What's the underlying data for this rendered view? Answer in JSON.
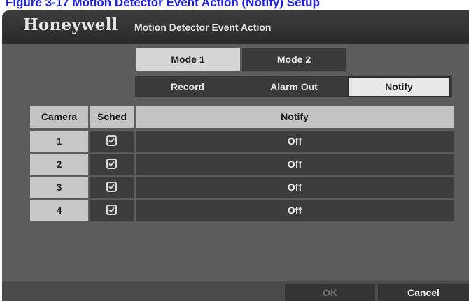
{
  "caption": "Figure 3-17     Motion Detector Event Action (Notify) Setup",
  "header": {
    "brand": "Honeywell",
    "title": "Motion Detector Event Action"
  },
  "mode_tabs": [
    {
      "label": "Mode 1",
      "selected": true
    },
    {
      "label": "Mode 2",
      "selected": false
    }
  ],
  "action_tabs": [
    {
      "label": "Record",
      "selected": false
    },
    {
      "label": "Alarm Out",
      "selected": false
    },
    {
      "label": "Notify",
      "selected": true
    }
  ],
  "table": {
    "columns": [
      "Camera",
      "Sched",
      "Notify"
    ],
    "rows": [
      {
        "camera": "1",
        "sched": true,
        "notify": "Off"
      },
      {
        "camera": "2",
        "sched": true,
        "notify": "Off"
      },
      {
        "camera": "3",
        "sched": true,
        "notify": "Off"
      },
      {
        "camera": "4",
        "sched": true,
        "notify": "Off"
      }
    ]
  },
  "footer": {
    "ok_label": "OK",
    "ok_enabled": false,
    "cancel_label": "Cancel"
  },
  "colors": {
    "caption": "#1f1fe0",
    "panel_background": "#5c5c5c",
    "selected_tab": "#d6d6d6",
    "dark_cell": "#3c3c3c"
  },
  "icons": [
    "checkbox-checked-icon"
  ]
}
